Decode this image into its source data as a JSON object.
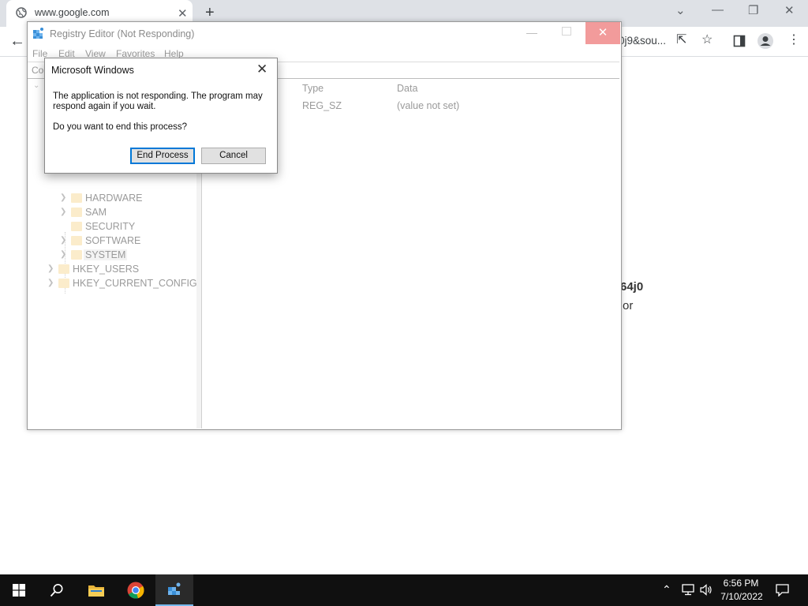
{
  "browser": {
    "tab_title": "www.google.com",
    "tab_close": "✕",
    "new_tab": "+",
    "url_tail": "0j9&sou...",
    "page_line1": "64j0",
    "page_line2": "or"
  },
  "regedit": {
    "title": "Registry Editor (Not Responding)",
    "menu": [
      "File",
      "Edit",
      "View",
      "Favorites",
      "Help"
    ],
    "address_label": "Co",
    "tree": [
      {
        "label": "HARDWARE",
        "level": 2
      },
      {
        "label": "SAM",
        "level": 2
      },
      {
        "label": "SECURITY",
        "level": 2
      },
      {
        "label": "SOFTWARE",
        "level": 2
      },
      {
        "label": "SYSTEM",
        "level": 2
      },
      {
        "label": "HKEY_USERS",
        "level": 1
      },
      {
        "label": "HKEY_CURRENT_CONFIG",
        "level": 1
      }
    ],
    "columns": {
      "type": "Type",
      "data": "Data"
    },
    "row": {
      "type": "REG_SZ",
      "data": "(value not set)"
    }
  },
  "dialog": {
    "title": "Microsoft Windows",
    "message": "The application is not responding. The program may respond again if you wait.",
    "question": "Do you want to end this process?",
    "end_process": "End Process",
    "cancel": "Cancel"
  },
  "taskbar": {
    "time": "6:56 PM",
    "date": "7/10/2022"
  }
}
